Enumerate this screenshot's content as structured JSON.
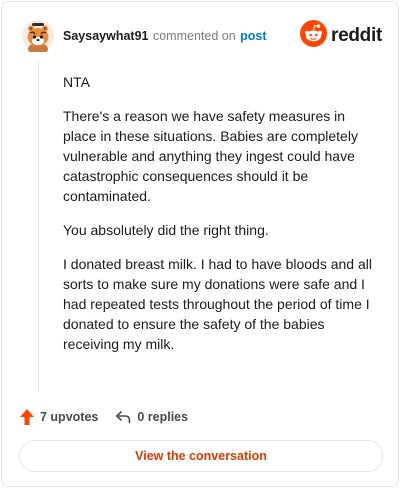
{
  "comment": {
    "username": "Saysaywhat91",
    "commented_text": "commented on",
    "post_link": "post",
    "avatar_icon": "snoo-avatar-icon",
    "paragraphs": [
      "NTA",
      "There's a reason we have safety measures in place in these situations. Babies are completely vulnerable and anything they ingest could have catastrophic consequences should it be contaminated.",
      "You absolutely did the right thing.",
      "I donated breast milk. I had to have bloods and all sorts to make sure my donations were safe and I had repeated tests throughout the period of time I donated to ensure the safety of the babies receiving my milk."
    ]
  },
  "brand": {
    "wordmark": "reddit",
    "icon": "reddit-logo-icon",
    "color": "#ff4500"
  },
  "stats": {
    "upvotes_label": "7 upvotes",
    "upvote_icon": "upvote-arrow-icon",
    "replies_label": "0 replies",
    "reply_icon": "reply-arrow-icon"
  },
  "actions": {
    "view_conversation_label": "View the conversation",
    "accent_color": "#d93a00"
  }
}
